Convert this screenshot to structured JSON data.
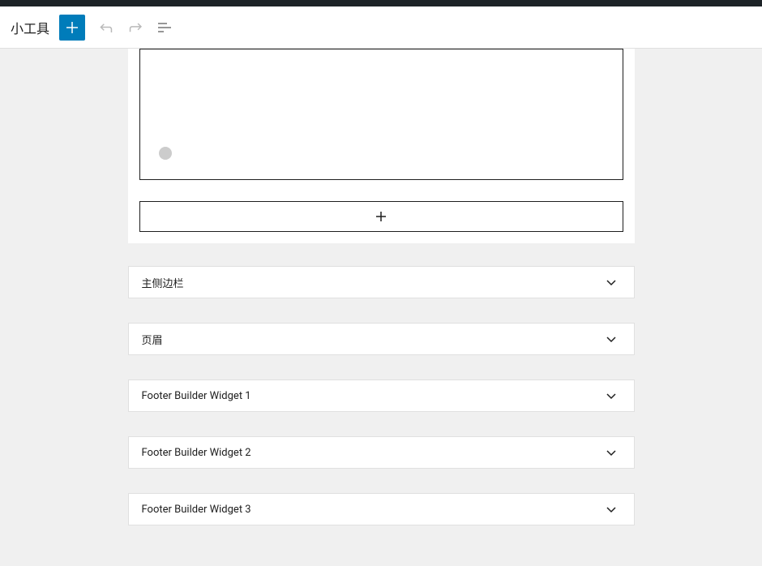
{
  "toolbar": {
    "title": "小工具",
    "add_label": "添加"
  },
  "widget_areas": [
    {
      "title": "主侧边栏"
    },
    {
      "title": "页眉"
    },
    {
      "title": "Footer Builder Widget 1"
    },
    {
      "title": "Footer Builder Widget 2"
    },
    {
      "title": "Footer Builder Widget 3"
    }
  ]
}
